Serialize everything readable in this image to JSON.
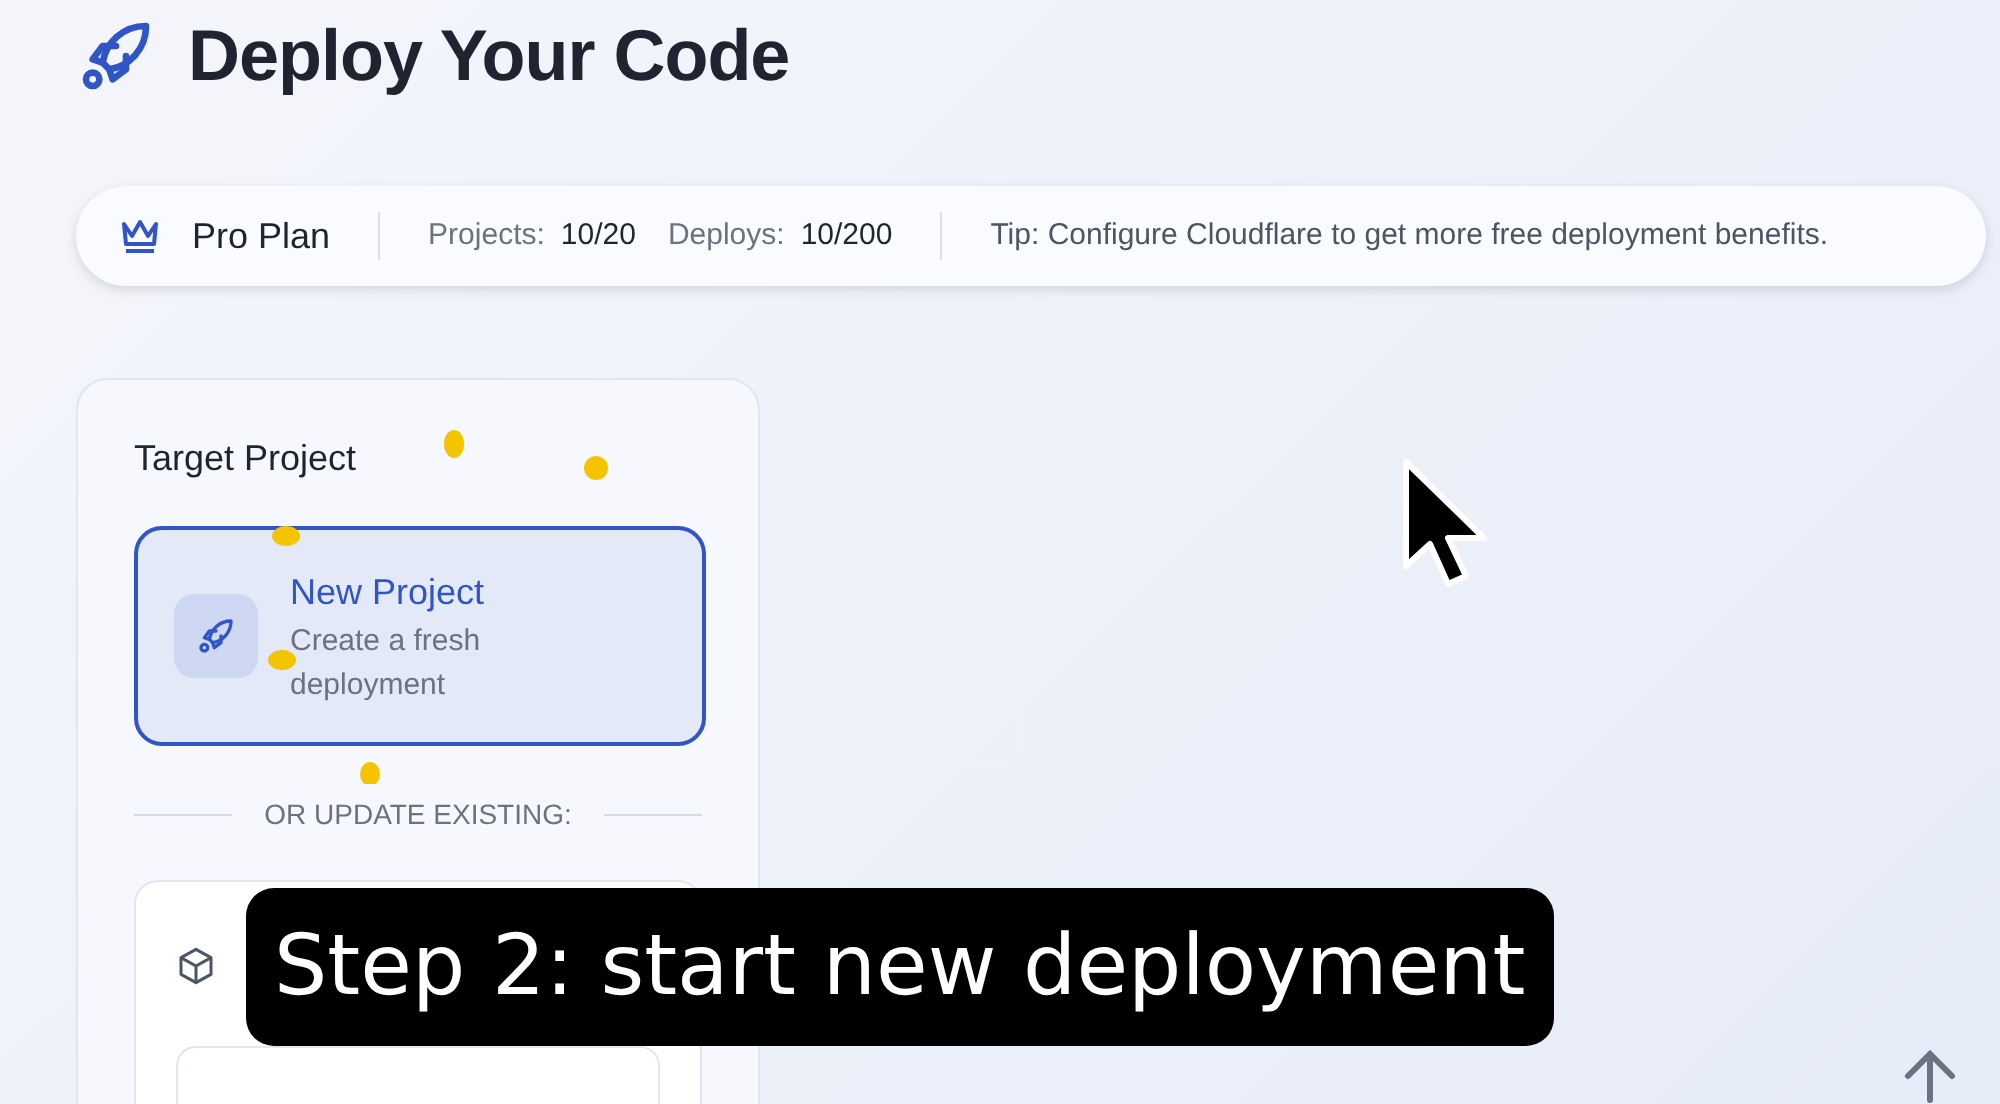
{
  "page_title": "Deploy Your Code",
  "plan_bar": {
    "plan": "Pro Plan",
    "stats": [
      {
        "label": "Projects:",
        "value": "10/20"
      },
      {
        "label": "Deploys:",
        "value": "10/200"
      }
    ],
    "tip": "Tip: Configure Cloudflare to get more free deployment benefits."
  },
  "target_project": {
    "heading": "Target Project",
    "options": [
      {
        "title": "New Project",
        "description": "Create a fresh deployment",
        "selected": true
      }
    ],
    "divider": "OR UPDATE EXISTING:"
  },
  "caption": "Step 2: start new deployment"
}
